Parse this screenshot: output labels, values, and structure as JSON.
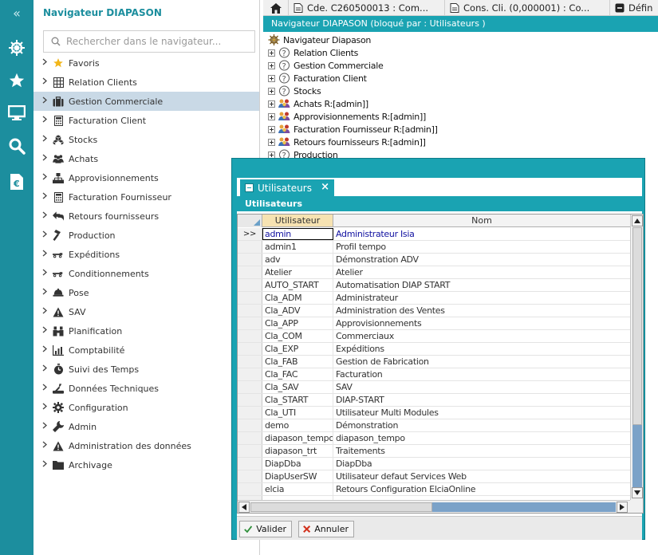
{
  "rail": {
    "collapse_glyph": "«",
    "items": [
      {
        "icon": "helm-icon",
        "active": true
      },
      {
        "icon": "star-icon",
        "active": false
      },
      {
        "icon": "monitor-icon",
        "active": false
      },
      {
        "icon": "search-icon",
        "active": false
      },
      {
        "icon": "euro-document-icon",
        "active": false
      }
    ]
  },
  "navigator": {
    "title": "Navigateur DIAPASON",
    "search_placeholder": "Rechercher dans le navigateur...",
    "items": [
      {
        "label": "Favoris",
        "icon": "star-icon"
      },
      {
        "label": "Relation Clients",
        "icon": "grid-icon"
      },
      {
        "label": "Gestion Commerciale",
        "icon": "briefcase-icon",
        "selected": true
      },
      {
        "label": "Facturation Client",
        "icon": "calculator-icon"
      },
      {
        "label": "Stocks",
        "icon": "cubes-icon"
      },
      {
        "label": "Achats",
        "icon": "people-icon"
      },
      {
        "label": "Approvisionnements",
        "icon": "network-icon"
      },
      {
        "label": "Facturation Fournisseur",
        "icon": "calculator-icon"
      },
      {
        "label": "Retours fournisseurs",
        "icon": "return-arrows-icon"
      },
      {
        "label": "Production",
        "icon": "hammer-icon"
      },
      {
        "label": "Expéditions",
        "icon": "truck-icon"
      },
      {
        "label": "Conditionnements",
        "icon": "truck-icon"
      },
      {
        "label": "Pose",
        "icon": "helmet-icon"
      },
      {
        "label": "SAV",
        "icon": "warning-icon"
      },
      {
        "label": "Planification",
        "icon": "binoculars-icon"
      },
      {
        "label": "Comptabilité",
        "icon": "bar-chart-icon"
      },
      {
        "label": "Suivi des Temps",
        "icon": "stopwatch-icon"
      },
      {
        "label": "Données Techniques",
        "icon": "tools-icon"
      },
      {
        "label": "Configuration",
        "icon": "gear-icon"
      },
      {
        "label": "Admin",
        "icon": "wrench-icon"
      },
      {
        "label": "Administration des données",
        "icon": "warning-icon"
      },
      {
        "label": "Archivage",
        "icon": "folder-icon"
      }
    ]
  },
  "tabs": [
    {
      "label": "Cde.  C260500013 : Com...",
      "icon": "document-icon"
    },
    {
      "label": "Cons. Cli. (0,000001)  : Co...",
      "icon": "document-icon"
    },
    {
      "label": "Défin",
      "icon": "minus-box-icon"
    }
  ],
  "tree": {
    "header": "Navigateur DIAPASON (bloqué par : Utilisateurs )",
    "root": "Navigateur Diapason",
    "nodes": [
      {
        "label": "Relation Clients",
        "icon": "question-node-icon"
      },
      {
        "label": "Gestion Commerciale",
        "icon": "question-node-icon"
      },
      {
        "label": "Facturation Client",
        "icon": "question-node-icon"
      },
      {
        "label": "Stocks",
        "icon": "question-node-icon"
      },
      {
        "label": "Achats R:[admin]]",
        "icon": "users-node-icon"
      },
      {
        "label": "Approvisionnements R:[admin]]",
        "icon": "users-node-icon"
      },
      {
        "label": "Facturation Fournisseur R:[admin]]",
        "icon": "users-node-icon"
      },
      {
        "label": "Retours fournisseurs R:[admin]]",
        "icon": "users-node-icon"
      },
      {
        "label": "Production",
        "icon": "question-node-icon"
      }
    ]
  },
  "modal": {
    "tab_label": "Utilisateurs",
    "subtitle": "Utilisateurs",
    "columns": [
      "Utilisateur",
      "Nom"
    ],
    "current_marker": ">>",
    "rows": [
      {
        "user": "admin",
        "name": "Administrateur Isia",
        "current": true
      },
      {
        "user": "admin1",
        "name": "Profil tempo"
      },
      {
        "user": "adv",
        "name": "Démonstration ADV"
      },
      {
        "user": "Atelier",
        "name": "Atelier"
      },
      {
        "user": "AUTO_START",
        "name": "Automatisation DIAP START"
      },
      {
        "user": "Cla_ADM",
        "name": "Administrateur"
      },
      {
        "user": "Cla_ADV",
        "name": "Administration des Ventes"
      },
      {
        "user": "Cla_APP",
        "name": "Approvisionnements"
      },
      {
        "user": "Cla_COM",
        "name": "Commerciaux"
      },
      {
        "user": "Cla_EXP",
        "name": "Expéditions"
      },
      {
        "user": "Cla_FAB",
        "name": "Gestion de Fabrication"
      },
      {
        "user": "Cla_FAC",
        "name": "Facturation"
      },
      {
        "user": "Cla_SAV",
        "name": "SAV"
      },
      {
        "user": "Cla_START",
        "name": "DIAP-START"
      },
      {
        "user": "Cla_UTI",
        "name": "Utilisateur Multi Modules"
      },
      {
        "user": "demo",
        "name": "Démonstration"
      },
      {
        "user": "diapason_tempo",
        "name": "diapason_tempo"
      },
      {
        "user": "diapason_trt",
        "name": "Traitements"
      },
      {
        "user": "DiapDba",
        "name": "DiapDba"
      },
      {
        "user": "DiapUserSW",
        "name": "Utilisateur defaut Services Web"
      },
      {
        "user": "elcia",
        "name": "Retours Configuration ElciaOnline"
      },
      {
        "user": "",
        "name": ""
      }
    ],
    "ok_label": "Valider",
    "cancel_label": "Annuler"
  },
  "colors": {
    "teal": "#1c8e9e",
    "header_teal": "#1aa3b2",
    "selection": "#c9d9e6"
  }
}
